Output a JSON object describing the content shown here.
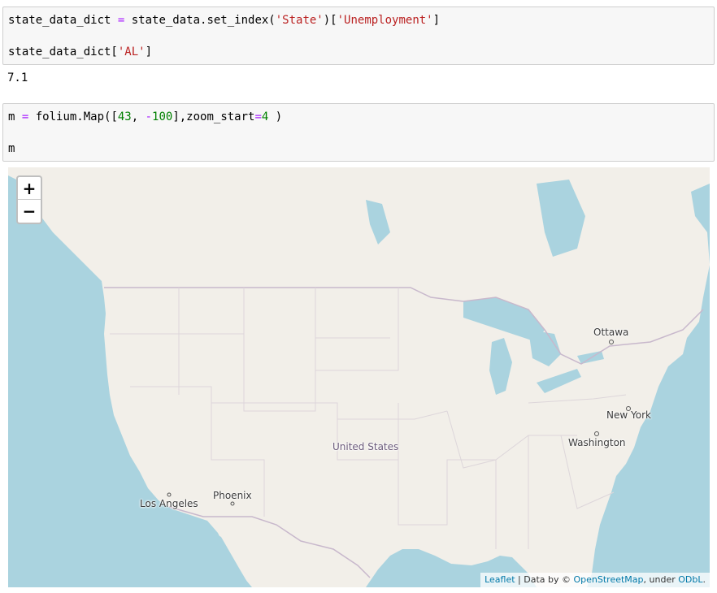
{
  "cells": {
    "cell1": {
      "line1": {
        "a": "state_data_dict ",
        "op": "=",
        "b": " state_data.set_index(",
        "s1": "'State'",
        "c": ")[",
        "s2": "'Unemployment'",
        "d": "]"
      },
      "line2": {
        "a": "state_data_dict[",
        "s1": "'AL'",
        "b": "]"
      }
    },
    "output1": "7.1",
    "cell2": {
      "line1": {
        "a": "m ",
        "op": "=",
        "b": " folium.Map([",
        "n1": "43",
        "c": ", ",
        "op2": "-",
        "n2": "100",
        "d": "],zoom_start",
        "op3": "=",
        "n3": "4",
        "e": " )"
      },
      "line2": "m"
    }
  },
  "map": {
    "zoom_in": "+",
    "zoom_out": "−",
    "labels": {
      "ottawa": "Ottawa",
      "new_york": "New York",
      "washington": "Washington",
      "united_states": "United States",
      "phoenix": "Phoenix",
      "los_angeles": "Los Angeles"
    },
    "attribution": {
      "leaflet": "Leaflet",
      "sep": " | Data by © ",
      "osm": "OpenStreetMap",
      "under": ", under ",
      "odbl": "ODbL",
      "end": "."
    },
    "colors": {
      "water": "#aad3df",
      "land": "#f2efe9",
      "border": "#c8b8cc"
    }
  }
}
